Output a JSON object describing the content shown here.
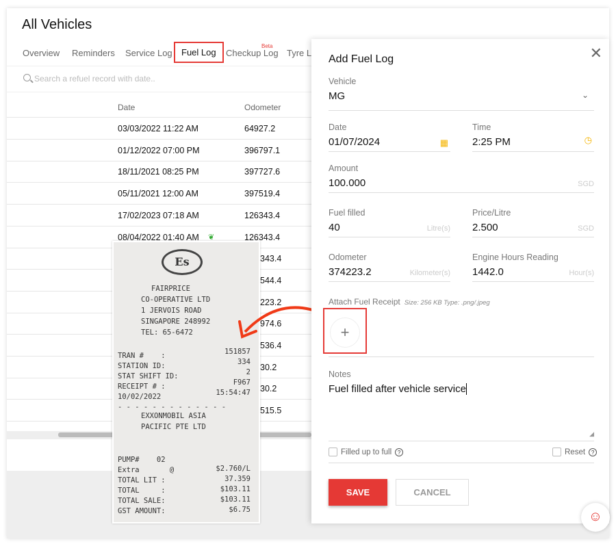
{
  "page": {
    "title": "All Vehicles"
  },
  "tabs": [
    {
      "label": "Overview"
    },
    {
      "label": "Reminders"
    },
    {
      "label": "Service Log"
    },
    {
      "label": "Fuel Log",
      "active": true
    },
    {
      "label": "Checkup Log",
      "badge": "Beta"
    },
    {
      "label": "Tyre Lo"
    }
  ],
  "search": {
    "placeholder": "Search a refuel record with date.."
  },
  "table": {
    "headers": {
      "date": "Date",
      "odometer": "Odometer"
    },
    "rows": [
      {
        "date": "03/03/2022 11:22 AM",
        "odometer": "64927.2"
      },
      {
        "date": "01/12/2022 07:00 PM",
        "odometer": "396797.1"
      },
      {
        "date": "18/11/2021 08:25 PM",
        "odometer": "397727.6"
      },
      {
        "date": "05/11/2021 12:00 AM",
        "odometer": "397519.4"
      },
      {
        "date": "17/02/2023 07:18 AM",
        "odometer": "126343.4"
      },
      {
        "date": "08/04/2022 01:40 AM",
        "odometer": "126343.4",
        "leaf": true
      },
      {
        "date": "",
        "odometer": "343.4"
      },
      {
        "date": "",
        "odometer": "544.4"
      },
      {
        "date": "",
        "odometer": "223.2"
      },
      {
        "date": "",
        "odometer": "974.6"
      },
      {
        "date": "",
        "odometer": "536.4"
      },
      {
        "date": "",
        "odometer": "30.2"
      },
      {
        "date": "",
        "odometer": "30.2"
      },
      {
        "date": "",
        "odometer": "515.5"
      }
    ]
  },
  "receipt": {
    "logo": "Es",
    "lines": [
      "FAIRPRICE",
      "CO-OPERATIVE LTD",
      "1 JERVOIS ROAD",
      "SINGAPORE 248992",
      "TEL: 65-6472"
    ],
    "fields": [
      [
        "TRAN #    :",
        "151857"
      ],
      [
        "STATION ID:",
        "334"
      ],
      [
        "STAT SHIFT ID:",
        "2"
      ],
      [
        "RECEIPT # :",
        "F967"
      ],
      [
        "10/02/2022",
        "15:54:47"
      ]
    ],
    "company": [
      "EXXONMOBIL ASIA",
      "PACIFIC PTE LTD"
    ],
    "totals": [
      [
        "PUMP#    02",
        ""
      ],
      [
        "Extra       @",
        "$2.760/L"
      ],
      [
        "TOTAL LIT :",
        "37.359"
      ],
      [
        "TOTAL     :",
        "$103.11"
      ],
      [
        "TOTAL SALE:",
        "$103.11"
      ],
      [
        "GST AMOUNT:",
        "$6.75"
      ]
    ]
  },
  "panel": {
    "title": "Add Fuel Log",
    "vehicle": {
      "label": "Vehicle",
      "value": "MG"
    },
    "date": {
      "label": "Date",
      "value": "01/07/2024"
    },
    "time": {
      "label": "Time",
      "value": "2:25 PM"
    },
    "amount": {
      "label": "Amount",
      "value": "100.000",
      "unit": "SGD"
    },
    "fuel": {
      "label": "Fuel filled",
      "value": "40",
      "unit": "Litre(s)"
    },
    "price": {
      "label": "Price/Litre",
      "value": "2.500",
      "unit": "SGD"
    },
    "odometer": {
      "label": "Odometer",
      "value": "374223.2",
      "unit": "Kilometer(s)"
    },
    "engine": {
      "label": "Engine Hours Reading",
      "value": "1442.0",
      "unit": "Hour(s)"
    },
    "attach": {
      "label": "Attach Fuel Receipt",
      "hint": "Size: 256 KB Type: .png/.jpeg"
    },
    "notes": {
      "label": "Notes",
      "value": "Fuel filled after vehicle service"
    },
    "filled_full": {
      "label": "Filled up to full",
      "checked": false
    },
    "reset": {
      "label": "Reset",
      "checked": false
    },
    "save": "SAVE",
    "cancel": "CANCEL"
  },
  "colors": {
    "accent": "#e53935",
    "icon_yellow": "#f5b400"
  }
}
